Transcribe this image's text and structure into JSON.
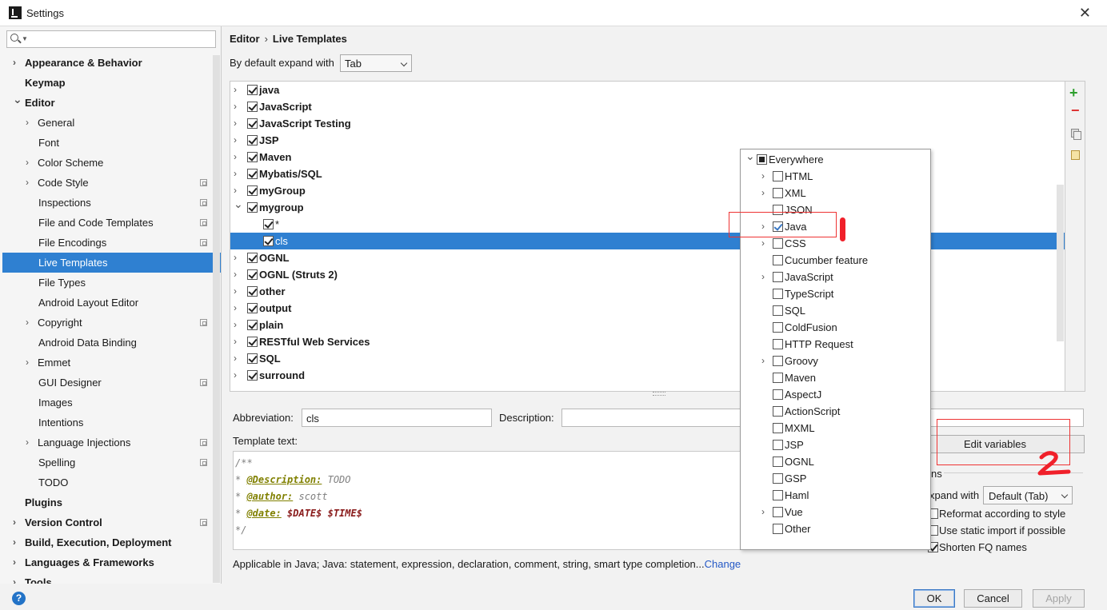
{
  "window": {
    "title": "Settings"
  },
  "sidebar": {
    "items": [
      {
        "label": "Appearance & Behavior",
        "bold": true,
        "arrow": "right",
        "indent": 0
      },
      {
        "label": "Keymap",
        "bold": true,
        "arrow": "",
        "indent": 0
      },
      {
        "label": "Editor",
        "bold": true,
        "arrow": "down",
        "indent": 0
      },
      {
        "label": "General",
        "bold": false,
        "arrow": "right",
        "indent": 1
      },
      {
        "label": "Font",
        "bold": false,
        "arrow": "",
        "indent": 1
      },
      {
        "label": "Color Scheme",
        "bold": false,
        "arrow": "right",
        "indent": 1
      },
      {
        "label": "Code Style",
        "bold": false,
        "arrow": "right",
        "indent": 1,
        "proj": true
      },
      {
        "label": "Inspections",
        "bold": false,
        "arrow": "",
        "indent": 1,
        "proj": true
      },
      {
        "label": "File and Code Templates",
        "bold": false,
        "arrow": "",
        "indent": 1,
        "proj": true
      },
      {
        "label": "File Encodings",
        "bold": false,
        "arrow": "",
        "indent": 1,
        "proj": true
      },
      {
        "label": "Live Templates",
        "bold": false,
        "arrow": "",
        "indent": 1,
        "selected": true
      },
      {
        "label": "File Types",
        "bold": false,
        "arrow": "",
        "indent": 1
      },
      {
        "label": "Android Layout Editor",
        "bold": false,
        "arrow": "",
        "indent": 1
      },
      {
        "label": "Copyright",
        "bold": false,
        "arrow": "right",
        "indent": 1,
        "proj": true
      },
      {
        "label": "Android Data Binding",
        "bold": false,
        "arrow": "",
        "indent": 1
      },
      {
        "label": "Emmet",
        "bold": false,
        "arrow": "right",
        "indent": 1
      },
      {
        "label": "GUI Designer",
        "bold": false,
        "arrow": "",
        "indent": 1,
        "proj": true
      },
      {
        "label": "Images",
        "bold": false,
        "arrow": "",
        "indent": 1
      },
      {
        "label": "Intentions",
        "bold": false,
        "arrow": "",
        "indent": 1
      },
      {
        "label": "Language Injections",
        "bold": false,
        "arrow": "right",
        "indent": 1,
        "proj": true
      },
      {
        "label": "Spelling",
        "bold": false,
        "arrow": "",
        "indent": 1,
        "proj": true
      },
      {
        "label": "TODO",
        "bold": false,
        "arrow": "",
        "indent": 1
      },
      {
        "label": "Plugins",
        "bold": true,
        "arrow": "",
        "indent": 0
      },
      {
        "label": "Version Control",
        "bold": true,
        "arrow": "right",
        "indent": 0,
        "proj": true
      },
      {
        "label": "Build, Execution, Deployment",
        "bold": true,
        "arrow": "right",
        "indent": 0
      },
      {
        "label": "Languages & Frameworks",
        "bold": true,
        "arrow": "right",
        "indent": 0
      },
      {
        "label": "Tools",
        "bold": true,
        "arrow": "right",
        "indent": 0
      }
    ]
  },
  "breadcrumb": {
    "parent": "Editor",
    "separator": "›",
    "current": "Live Templates"
  },
  "expand": {
    "label": "By default expand with",
    "value": "Tab"
  },
  "tree": {
    "rows": [
      {
        "label": "java",
        "level": 0,
        "arrow": "right",
        "checked": true
      },
      {
        "label": "JavaScript",
        "level": 0,
        "arrow": "right",
        "checked": true
      },
      {
        "label": "JavaScript Testing",
        "level": 0,
        "arrow": "right",
        "checked": true
      },
      {
        "label": "JSP",
        "level": 0,
        "arrow": "right",
        "checked": true
      },
      {
        "label": "Maven",
        "level": 0,
        "arrow": "right",
        "checked": true
      },
      {
        "label": "Mybatis/SQL",
        "level": 0,
        "arrow": "right",
        "checked": true
      },
      {
        "label": "myGroup",
        "level": 0,
        "arrow": "right",
        "checked": true
      },
      {
        "label": "mygroup",
        "level": 0,
        "arrow": "down",
        "checked": true
      },
      {
        "label": "*",
        "level": 1,
        "arrow": "",
        "checked": true
      },
      {
        "label": "cls",
        "level": 1,
        "arrow": "",
        "checked": true,
        "selected": true
      },
      {
        "label": "OGNL",
        "level": 0,
        "arrow": "right",
        "checked": true
      },
      {
        "label": "OGNL (Struts 2)",
        "level": 0,
        "arrow": "right",
        "checked": true
      },
      {
        "label": "other",
        "level": 0,
        "arrow": "right",
        "checked": true
      },
      {
        "label": "output",
        "level": 0,
        "arrow": "right",
        "checked": true
      },
      {
        "label": "plain",
        "level": 0,
        "arrow": "right",
        "checked": true
      },
      {
        "label": "RESTful Web Services",
        "level": 0,
        "arrow": "right",
        "checked": true
      },
      {
        "label": "SQL",
        "level": 0,
        "arrow": "right",
        "checked": true
      },
      {
        "label": "surround",
        "level": 0,
        "arrow": "right",
        "checked": true
      }
    ]
  },
  "context_popup": {
    "rows": [
      {
        "label": "Everywhere",
        "level": 0,
        "arrow": "down",
        "state": "partial"
      },
      {
        "label": "HTML",
        "level": 1,
        "arrow": "right",
        "state": "unchecked"
      },
      {
        "label": "XML",
        "level": 1,
        "arrow": "right",
        "state": "unchecked"
      },
      {
        "label": "JSON",
        "level": 1,
        "arrow": "",
        "state": "unchecked"
      },
      {
        "label": "Java",
        "level": 1,
        "arrow": "right",
        "state": "checked"
      },
      {
        "label": "CSS",
        "level": 1,
        "arrow": "right",
        "state": "unchecked"
      },
      {
        "label": "Cucumber feature",
        "level": 1,
        "arrow": "",
        "state": "unchecked"
      },
      {
        "label": "JavaScript",
        "level": 1,
        "arrow": "right",
        "state": "unchecked"
      },
      {
        "label": "TypeScript",
        "level": 1,
        "arrow": "",
        "state": "unchecked"
      },
      {
        "label": "SQL",
        "level": 1,
        "arrow": "",
        "state": "unchecked"
      },
      {
        "label": "ColdFusion",
        "level": 1,
        "arrow": "",
        "state": "unchecked"
      },
      {
        "label": "HTTP Request",
        "level": 1,
        "arrow": "",
        "state": "unchecked"
      },
      {
        "label": "Groovy",
        "level": 1,
        "arrow": "right",
        "state": "unchecked"
      },
      {
        "label": "Maven",
        "level": 1,
        "arrow": "",
        "state": "unchecked"
      },
      {
        "label": "AspectJ",
        "level": 1,
        "arrow": "",
        "state": "unchecked"
      },
      {
        "label": "ActionScript",
        "level": 1,
        "arrow": "",
        "state": "unchecked"
      },
      {
        "label": "MXML",
        "level": 1,
        "arrow": "",
        "state": "unchecked"
      },
      {
        "label": "JSP",
        "level": 1,
        "arrow": "",
        "state": "unchecked"
      },
      {
        "label": "OGNL",
        "level": 1,
        "arrow": "",
        "state": "unchecked"
      },
      {
        "label": "GSP",
        "level": 1,
        "arrow": "",
        "state": "unchecked"
      },
      {
        "label": "Haml",
        "level": 1,
        "arrow": "",
        "state": "unchecked"
      },
      {
        "label": "Vue",
        "level": 1,
        "arrow": "right",
        "state": "unchecked"
      },
      {
        "label": "Other",
        "level": 1,
        "arrow": "",
        "state": "unchecked"
      }
    ]
  },
  "editor": {
    "abbreviation_label": "Abbreviation:",
    "abbreviation_value": "cls",
    "description_label": "Description:",
    "template_text_label": "Template text:",
    "template": {
      "line1": "/**",
      "line2_prefix": "* ",
      "line2_tag": "@Description:",
      "line2_value": " TODO",
      "line3_prefix": "* ",
      "line3_tag": "@author:",
      "line3_value": " scott",
      "line4_prefix": "* ",
      "line4_tag": "@date:",
      "line4_value": " $DATE$ $TIME$",
      "line5": "*/"
    },
    "applicable_text": "Applicable in Java; Java: statement, expression, declaration, comment, string, smart type completion...",
    "change_link": "Change"
  },
  "options": {
    "edit_variables": "Edit variables",
    "section_label": "ns",
    "expand_label": "xpand with",
    "expand_value": "Default (Tab)",
    "reformat": "Reformat according to style",
    "static_import": "Use static import if possible",
    "shorten_fq": "Shorten FQ names"
  },
  "buttons": {
    "ok": "OK",
    "cancel": "Cancel",
    "apply": "Apply",
    "help": "?"
  },
  "colors": {
    "selection": "#2f80d1",
    "link": "#2458c6",
    "annotation_red": "#f0202a"
  }
}
